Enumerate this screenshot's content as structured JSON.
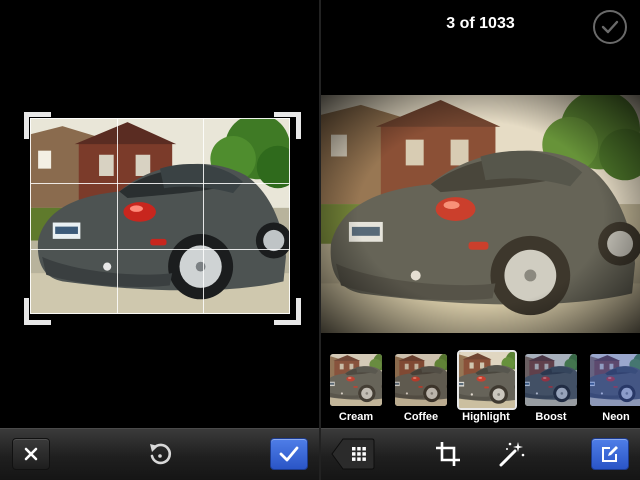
{
  "crop_view": {
    "cancel_icon": "close-icon",
    "rotate_icon": "rotate-icon",
    "confirm_icon": "checkmark-icon"
  },
  "editor_view": {
    "counter": "3 of 1033",
    "done_icon": "circle-check-icon",
    "filters": [
      {
        "label": "Cream",
        "tint": "#a58c6a"
      },
      {
        "label": "Coffee",
        "tint": "#8a6a48"
      },
      {
        "label": "Highlight",
        "tint": "#c0a070",
        "selected": true
      },
      {
        "label": "Boost",
        "tint": "#2d4a8a"
      },
      {
        "label": "Neon",
        "tint": "#3a5cc0"
      }
    ],
    "toolbar": {
      "back_icon": "grid-icon",
      "crop_icon": "crop-icon",
      "enhance_icon": "magic-wand-icon",
      "edit_icon": "edit-icon"
    }
  },
  "colors": {
    "accent_blue": "#3a66d8",
    "toolbar": "#2a2a2a",
    "background": "#000000"
  }
}
